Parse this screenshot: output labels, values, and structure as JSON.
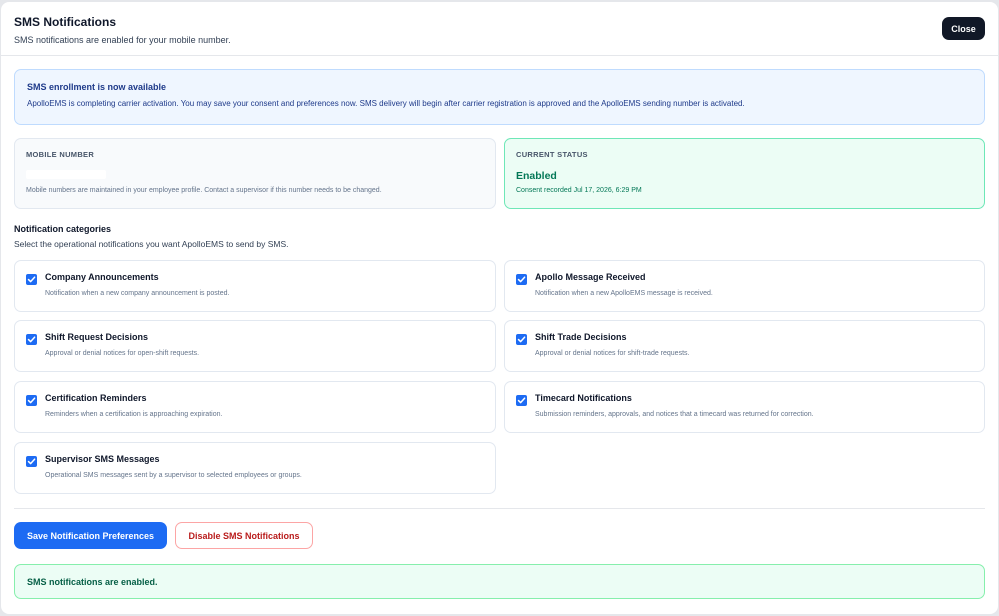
{
  "dialog": {
    "title": "SMS Notifications",
    "subtitle": "SMS notifications are enabled for your mobile number.",
    "close_label": "Close"
  },
  "info": {
    "title": "SMS enrollment is now available",
    "text": "ApolloEMS is completing carrier activation. You may save your consent and preferences now. SMS delivery will begin after carrier registration is approved and the ApolloEMS sending number is activated."
  },
  "mobile": {
    "label": "MOBILE NUMBER",
    "value": "",
    "note": "Mobile numbers are maintained in your employee profile. Contact a supervisor if this number needs to be changed."
  },
  "status": {
    "label": "CURRENT STATUS",
    "value": "Enabled",
    "note": "Consent recorded Jul 17, 2026, 6:29 PM"
  },
  "categories": {
    "title": "Notification categories",
    "subtitle": "Select the operational notifications you want ApolloEMS to send by SMS.",
    "items": [
      {
        "name": "Company Announcements",
        "desc": "Notification when a new company announcement is posted.",
        "checked": true
      },
      {
        "name": "Apollo Message Received",
        "desc": "Notification when a new ApolloEMS message is received.",
        "checked": true
      },
      {
        "name": "Shift Request Decisions",
        "desc": "Approval or denial notices for open-shift requests.",
        "checked": true
      },
      {
        "name": "Shift Trade Decisions",
        "desc": "Approval or denial notices for shift-trade requests.",
        "checked": true
      },
      {
        "name": "Certification Reminders",
        "desc": "Reminders when a certification is approaching expiration.",
        "checked": true
      },
      {
        "name": "Timecard Notifications",
        "desc": "Submission reminders, approvals, and notices that a timecard was returned for correction.",
        "checked": true
      },
      {
        "name": "Supervisor SMS Messages",
        "desc": "Operational SMS messages sent by a supervisor to selected employees or groups.",
        "checked": true
      }
    ]
  },
  "actions": {
    "save_label": "Save Notification Preferences",
    "disable_label": "Disable SMS Notifications"
  },
  "message": {
    "text": "SMS notifications are enabled."
  },
  "colors": {
    "primary": "#1d6bf3",
    "success": "#047857",
    "danger": "#b91c1c"
  }
}
